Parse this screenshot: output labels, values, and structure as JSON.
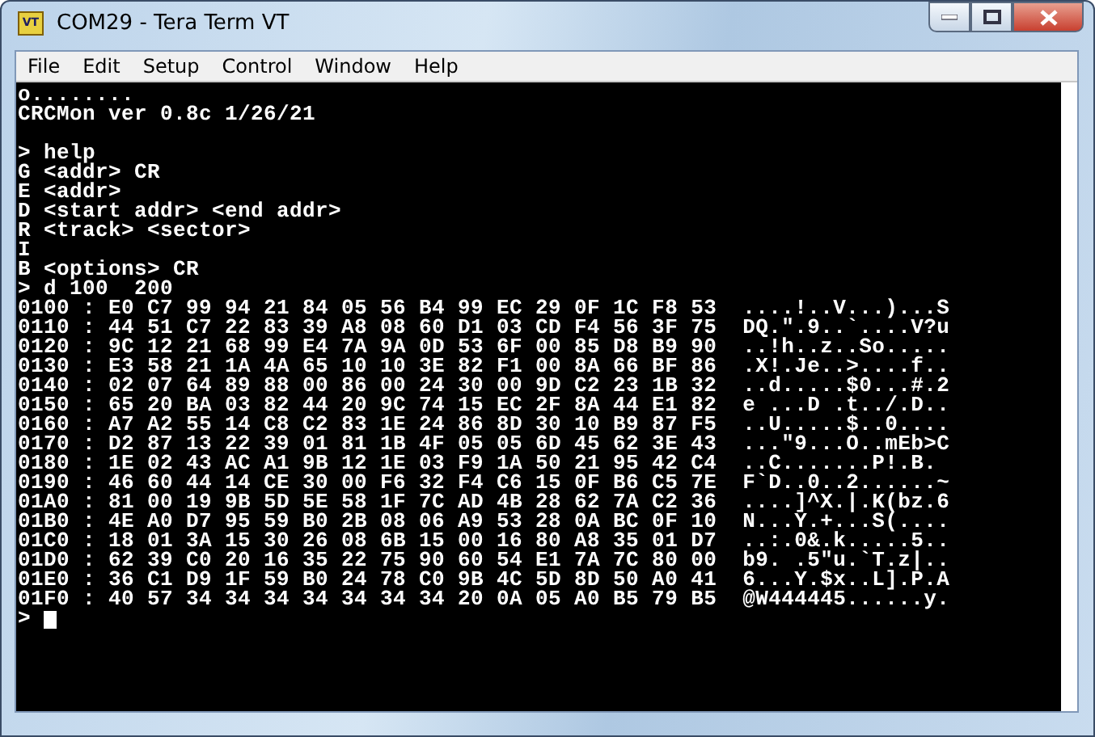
{
  "window": {
    "title": "COM29 - Tera Term VT",
    "icon_label": "VT"
  },
  "menu": [
    "File",
    "Edit",
    "Setup",
    "Control",
    "Window",
    "Help"
  ],
  "terminal": {
    "blocks": [
      [
        "o........",
        "CRCMon ver 0.8c 1/26/21"
      ],
      [
        "> help",
        "G <addr> CR",
        "E <addr>",
        "D <start addr> <end addr>",
        "R <track> <sector>",
        "I",
        "B <options> CR",
        "> d 100  200",
        "0100 : E0 C7 99 94 21 84 05 56 B4 99 EC 29 0F 1C F8 53  ....!..V...)...S",
        "0110 : 44 51 C7 22 83 39 A8 08 60 D1 03 CD F4 56 3F 75  DQ.\".9..`....V?u",
        "0120 : 9C 12 21 68 99 E4 7A 9A 0D 53 6F 00 85 D8 B9 90  ..!h..z..So.....",
        "0130 : E3 58 21 1A 4A 65 10 10 3E 82 F1 00 8A 66 BF 86  .X!.Je..>....f..",
        "0140 : 02 07 64 89 88 00 86 00 24 30 00 9D C2 23 1B 32  ..d.....$0...#.2",
        "0150 : 65 20 BA 03 82 44 20 9C 74 15 EC 2F 8A 44 E1 82  e ...D .t../.D..",
        "0160 : A7 A2 55 14 C8 C2 83 1E 24 86 8D 30 10 B9 87 F5  ..U.....$..0....",
        "0170 : D2 87 13 22 39 01 81 1B 4F 05 05 6D 45 62 3E 43  ...\"9...O..mEb>C",
        "0180 : 1E 02 43 AC A1 9B 12 1E 03 F9 1A 50 21 95 42 C4  ..C.......P!.B.",
        "0190 : 46 60 44 14 CE 30 00 F6 32 F4 C6 15 0F B6 C5 7E  F`D..0..2......~",
        "01A0 : 81 00 19 9B 5D 5E 58 1F 7C AD 4B 28 62 7A C2 36  ....]^X.|.K(bz.6",
        "01B0 : 4E A0 D7 95 59 B0 2B 08 06 A9 53 28 0A BC 0F 10  N...Y.+...S(....",
        "01C0 : 18 01 3A 15 30 26 08 6B 15 00 16 80 A8 35 01 D7  ..:.0&.k.....5..",
        "01D0 : 62 39 C0 20 16 35 22 75 90 60 54 E1 7A 7C 80 00  b9. .5\"u.`T.z|..",
        "01E0 : 36 C1 D9 1F 59 B0 24 78 C0 9B 4C 5D 8D 50 A0 41  6...Y.$x..L].P.A",
        "01F0 : 40 57 34 34 34 34 34 34 34 20 0A 05 A0 B5 79 B5  @W444445......y."
      ]
    ],
    "prompt": ">",
    "cursor_visible": true
  }
}
